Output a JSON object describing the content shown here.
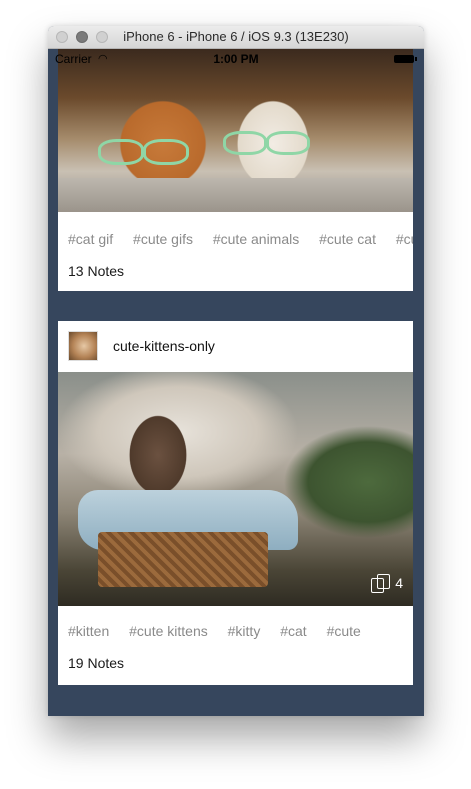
{
  "window": {
    "title": "iPhone 6 - iPhone 6 / iOS 9.3 (13E230)"
  },
  "status_bar": {
    "carrier": "Carrier",
    "time": "1:00 PM"
  },
  "posts": [
    {
      "tags": [
        "#cat gif",
        "#cute gifs",
        "#cute animals",
        "#cute cat",
        "#cute"
      ],
      "notes": "13 Notes"
    },
    {
      "blog_name": "cute-kittens-only",
      "photo_count": "4",
      "tags": [
        "#kitten",
        "#cute kittens",
        "#kitty",
        "#cat",
        "#cute"
      ],
      "notes": "19 Notes"
    }
  ],
  "colors": {
    "dashboard_background": "#36465d",
    "tag_text": "#8a8a8a"
  },
  "icons": {
    "wifi": "wifi-icon",
    "battery": "battery-icon",
    "reblog": "photoset-icon"
  }
}
